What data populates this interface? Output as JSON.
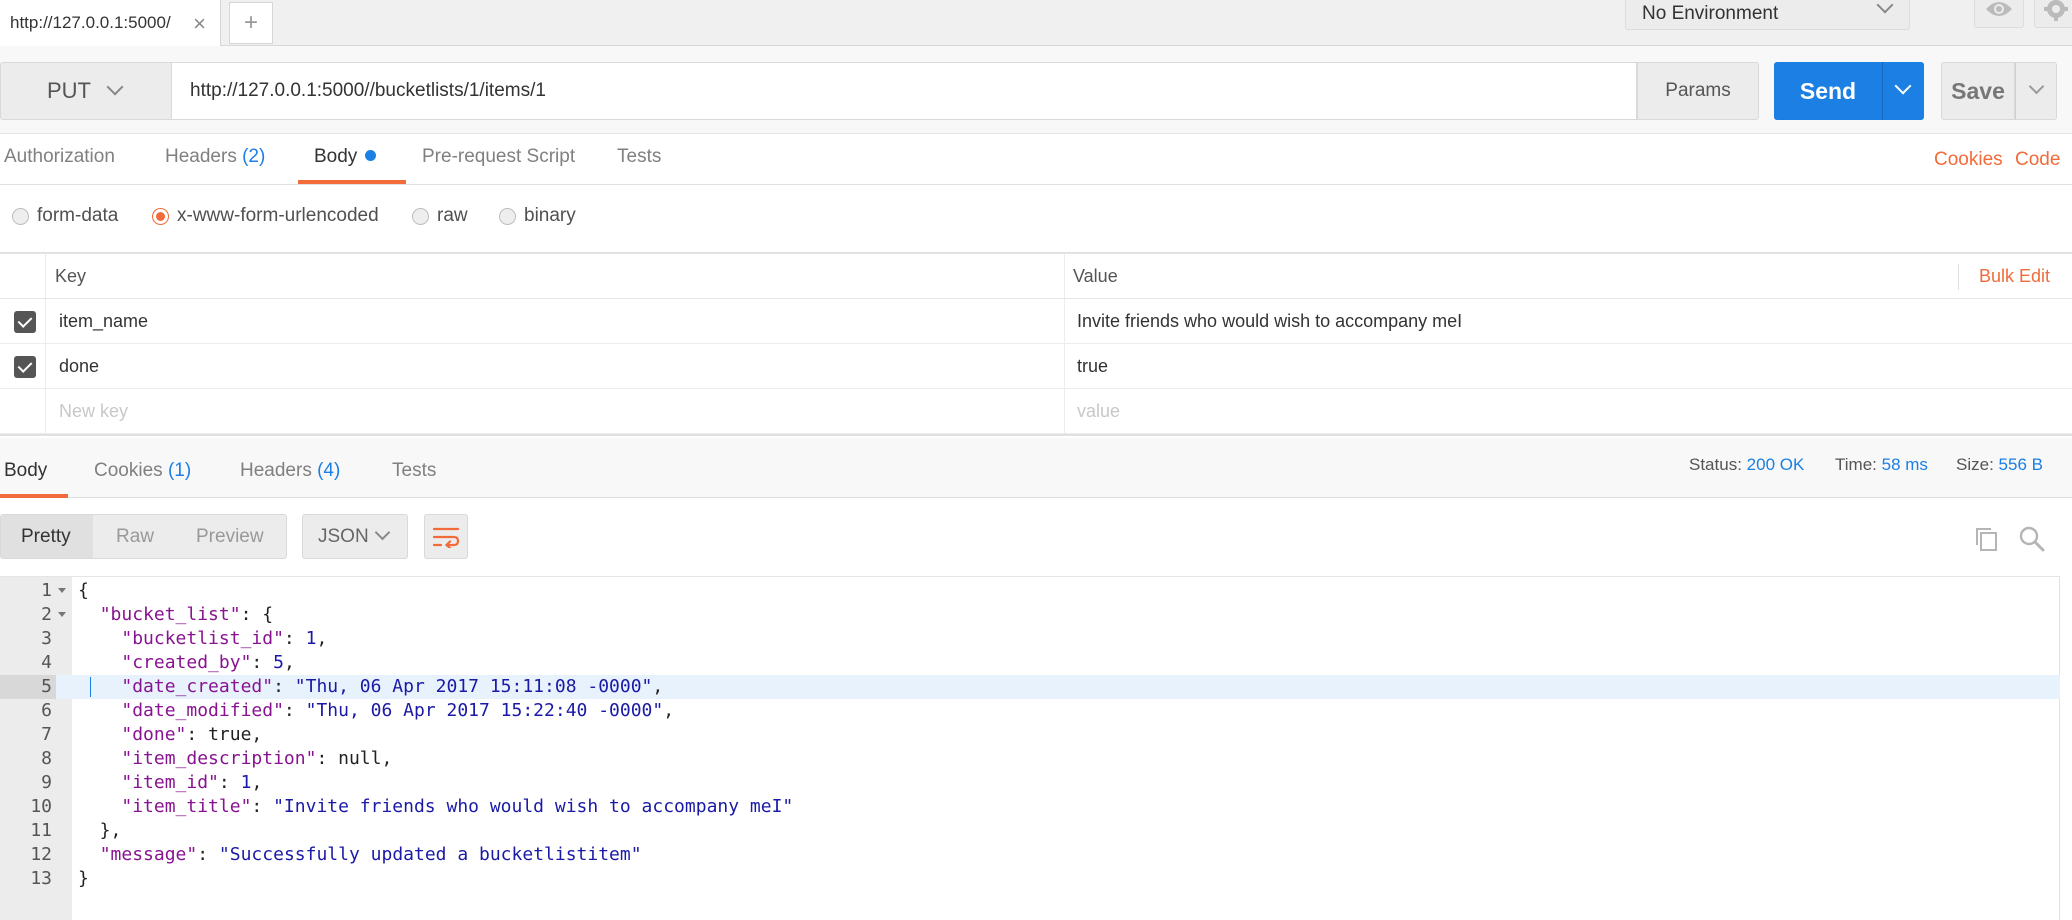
{
  "tabs": {
    "active_tab_label": "http://127.0.0.1:5000/",
    "close_symbol": "×",
    "new_tab_symbol": "+"
  },
  "environment": {
    "selected": "No Environment"
  },
  "request": {
    "method": "PUT",
    "url": "http://127.0.0.1:5000//bucketlists/1/items/1",
    "params_label": "Params",
    "send_label": "Send",
    "save_label": "Save"
  },
  "request_tabs": {
    "authorization": "Authorization",
    "headers": "Headers",
    "headers_count": "(2)",
    "body": "Body",
    "pre_request": "Pre-request Script",
    "tests": "Tests",
    "cookies_link": "Cookies",
    "code_link": "Code"
  },
  "body_types": {
    "form_data": "form-data",
    "urlencoded": "x-www-form-urlencoded",
    "raw": "raw",
    "binary": "binary",
    "selected": "x-www-form-urlencoded"
  },
  "kv_table": {
    "key_header": "Key",
    "value_header": "Value",
    "bulk_edit": "Bulk Edit",
    "rows": [
      {
        "key": "item_name",
        "value": "Invite friends who would wish to accompany meI",
        "checked": true
      },
      {
        "key": "done",
        "value": "true",
        "checked": true
      }
    ],
    "new_key_placeholder": "New key",
    "new_value_placeholder": "value"
  },
  "response_tabs": {
    "body": "Body",
    "cookies": "Cookies",
    "cookies_count": "(1)",
    "headers": "Headers",
    "headers_count": "(4)",
    "tests": "Tests"
  },
  "response_meta": {
    "status_label": "Status:",
    "status_value": "200 OK",
    "time_label": "Time:",
    "time_value": "58 ms",
    "size_label": "Size:",
    "size_value": "556 B"
  },
  "view_options": {
    "pretty": "Pretty",
    "raw": "Raw",
    "preview": "Preview",
    "format": "JSON"
  },
  "code_lines": [
    {
      "n": "1",
      "fold": true,
      "parts": [
        [
          "p",
          "{"
        ]
      ]
    },
    {
      "n": "2",
      "fold": true,
      "parts": [
        [
          "p",
          "  "
        ],
        [
          "k",
          "\"bucket_list\""
        ],
        [
          "p",
          ": {"
        ]
      ]
    },
    {
      "n": "3",
      "parts": [
        [
          "p",
          "    "
        ],
        [
          "k",
          "\"bucketlist_id\""
        ],
        [
          "p",
          ": "
        ],
        [
          "n",
          "1"
        ],
        [
          "p",
          ","
        ]
      ]
    },
    {
      "n": "4",
      "parts": [
        [
          "p",
          "    "
        ],
        [
          "k",
          "\"created_by\""
        ],
        [
          "p",
          ": "
        ],
        [
          "n",
          "5"
        ],
        [
          "p",
          ","
        ]
      ]
    },
    {
      "n": "5",
      "hl": true,
      "parts": [
        [
          "p",
          "    "
        ],
        [
          "k",
          "\"date_created\""
        ],
        [
          "p",
          ": "
        ],
        [
          "s",
          "\"Thu, 06 Apr 2017 15:11:08 -0000\""
        ],
        [
          "p",
          ","
        ]
      ]
    },
    {
      "n": "6",
      "parts": [
        [
          "p",
          "    "
        ],
        [
          "k",
          "\"date_modified\""
        ],
        [
          "p",
          ": "
        ],
        [
          "s",
          "\"Thu, 06 Apr 2017 15:22:40 -0000\""
        ],
        [
          "p",
          ","
        ]
      ]
    },
    {
      "n": "7",
      "parts": [
        [
          "p",
          "    "
        ],
        [
          "k",
          "\"done\""
        ],
        [
          "p",
          ": true,"
        ]
      ]
    },
    {
      "n": "8",
      "parts": [
        [
          "p",
          "    "
        ],
        [
          "k",
          "\"item_description\""
        ],
        [
          "p",
          ": null,"
        ]
      ]
    },
    {
      "n": "9",
      "parts": [
        [
          "p",
          "    "
        ],
        [
          "k",
          "\"item_id\""
        ],
        [
          "p",
          ": "
        ],
        [
          "n",
          "1"
        ],
        [
          "p",
          ","
        ]
      ]
    },
    {
      "n": "10",
      "parts": [
        [
          "p",
          "    "
        ],
        [
          "k",
          "\"item_title\""
        ],
        [
          "p",
          ": "
        ],
        [
          "s",
          "\"Invite friends who would wish to accompany meI\""
        ]
      ]
    },
    {
      "n": "11",
      "parts": [
        [
          "p",
          "  },"
        ]
      ]
    },
    {
      "n": "12",
      "parts": [
        [
          "p",
          "  "
        ],
        [
          "k",
          "\"message\""
        ],
        [
          "p",
          ": "
        ],
        [
          "s",
          "\"Successfully updated a bucketlistitem\""
        ]
      ]
    },
    {
      "n": "13",
      "parts": [
        [
          "p",
          "}"
        ]
      ]
    }
  ],
  "colors": {
    "accent_orange": "#f26b3a",
    "primary_blue": "#1b7fe3"
  }
}
